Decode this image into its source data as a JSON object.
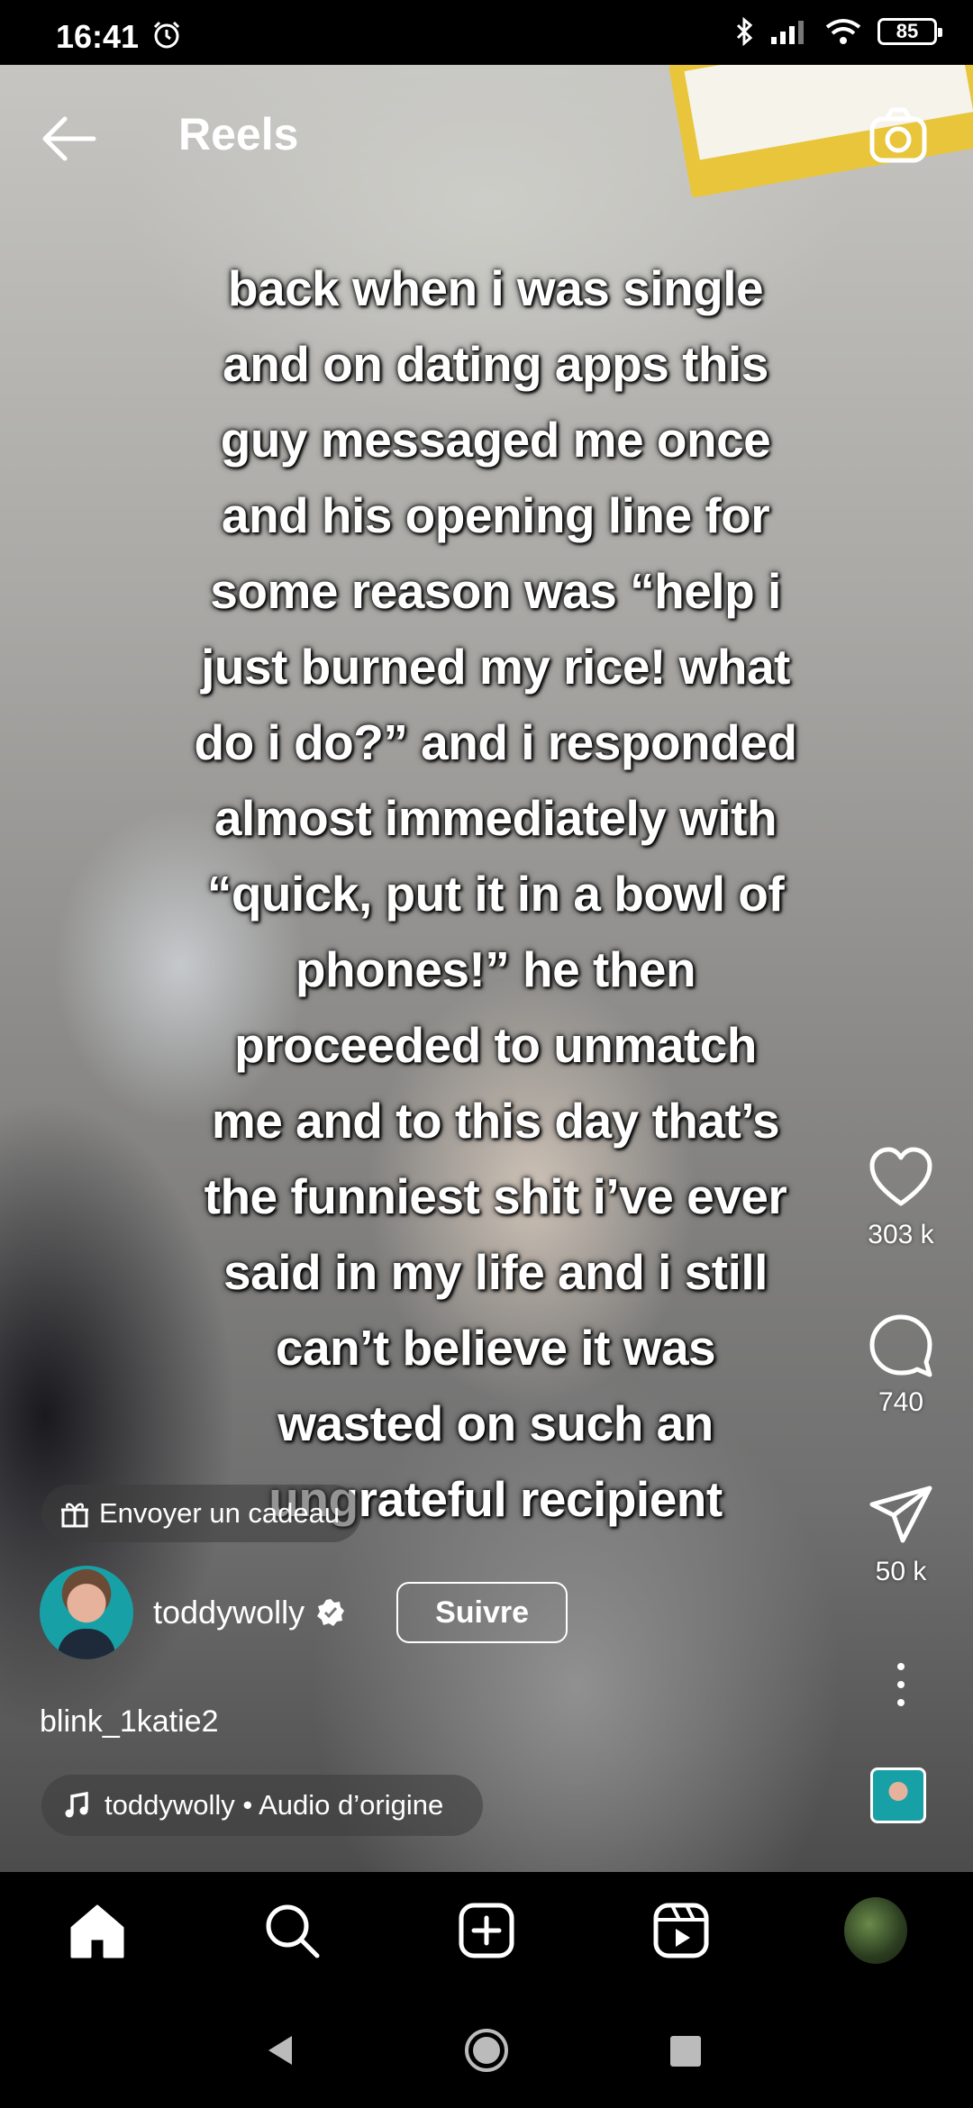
{
  "status_bar": {
    "time": "16:41",
    "battery": "85"
  },
  "header": {
    "title": "Reels"
  },
  "reel": {
    "caption": "back when i was single\nand on dating apps this\nguy messaged me once\nand his opening line for\nsome reason was “help i\njust burned my rice! what\ndo i do?” and i responded\nalmost immediately with\n“quick, put it in a bowl of\nphones!” he then\nproceeded to unmatch\nme and to this day that’s\nthe funniest shit i’ve ever\nsaid in my life and i still\ncan’t believe it was\nwasted on such an\nungrateful recipient",
    "gift_label": "Envoyer un cadeau",
    "username": "toddywolly",
    "follow_label": "Suivre",
    "coauthor": "blink_1katie2",
    "audio_label": "toddywolly • Audio d’origine"
  },
  "actions": {
    "likes": "303 k",
    "comments": "740",
    "shares": "50 k"
  },
  "icons": {
    "back": "arrow-left-icon",
    "camera": "camera-icon",
    "like": "heart-icon",
    "comment": "comment-icon",
    "share": "send-icon",
    "more": "more-vertical-icon",
    "gift": "gift-icon",
    "music": "music-note-icon",
    "verified": "verified-badge-icon",
    "nav_home": "home-icon",
    "nav_search": "search-icon",
    "nav_create": "add-post-icon",
    "nav_reels": "reels-icon"
  },
  "colors": {
    "verified_badge": "#ffffff",
    "nav_background": "#000000"
  }
}
